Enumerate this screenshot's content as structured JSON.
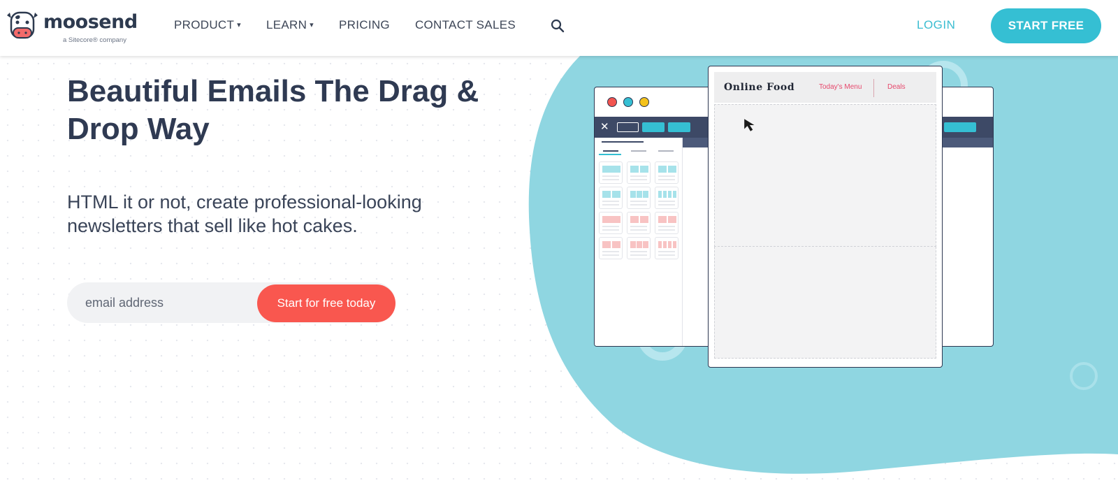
{
  "brand": {
    "name": "moosend",
    "tagline": "a Sitecore® company"
  },
  "nav": {
    "items": [
      {
        "label": "PRODUCT",
        "caret": "▾"
      },
      {
        "label": "LEARN",
        "caret": "▾"
      },
      {
        "label": "PRICING"
      },
      {
        "label": "CONTACT SALES"
      }
    ],
    "search_icon": "search-icon",
    "login_label": "LOGIN",
    "cta_label": "START FREE"
  },
  "hero": {
    "title_line1": "Beautiful Emails The Drag &",
    "title_line2": "Drop Way",
    "subtitle_line1": "HTML it or not, create professional-looking",
    "subtitle_line2": "newsletters that sell like hot cakes.",
    "email_placeholder": "email address",
    "cta_label": "Start for free today"
  },
  "illustration": {
    "window_title": "Online Food",
    "menu_link": "Today's Menu",
    "deals_link": "Deals",
    "close_glyph": "✕"
  },
  "colors": {
    "accent": "#35bfd3",
    "cta": "#f9574f",
    "heading": "#2f3a52",
    "blob": "#8fd6e1"
  }
}
